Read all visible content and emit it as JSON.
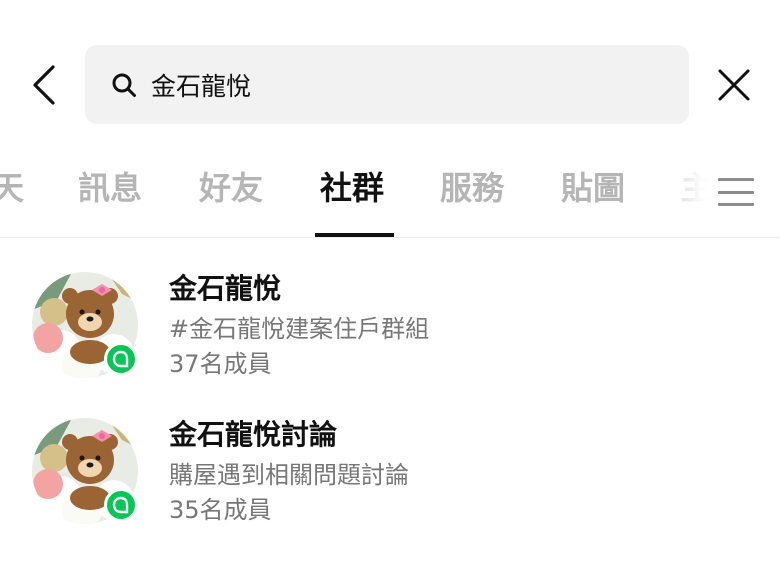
{
  "search": {
    "query": "金石龍悅",
    "back_icon": "chevron-left-icon",
    "search_icon": "search-icon",
    "clear_icon": "close-icon"
  },
  "tabs": [
    {
      "label": "天",
      "active": false
    },
    {
      "label": "訊息",
      "active": false
    },
    {
      "label": "好友",
      "active": false
    },
    {
      "label": "社群",
      "active": true
    },
    {
      "label": "服務",
      "active": false
    },
    {
      "label": "貼圖",
      "active": false
    },
    {
      "label": "主",
      "active": false
    }
  ],
  "menu_icon": "hamburger-menu-icon",
  "results": [
    {
      "name": "金石龍悅",
      "description": "#金石龍悅建案住戶群組",
      "members": "37名成員",
      "avatar_icon": "bear-avatar-icon",
      "badge_icon": "openchat-badge-icon"
    },
    {
      "name": "金石龍悅討論",
      "description": "購屋遇到相關問題討論",
      "members": "35名成員",
      "avatar_icon": "bear-avatar-icon",
      "badge_icon": "openchat-badge-icon"
    }
  ],
  "colors": {
    "accent_green": "#06c755",
    "text_primary": "#111111",
    "text_secondary": "#777777",
    "tab_inactive": "#b5b5b5",
    "search_bg": "#f2f2f2"
  }
}
